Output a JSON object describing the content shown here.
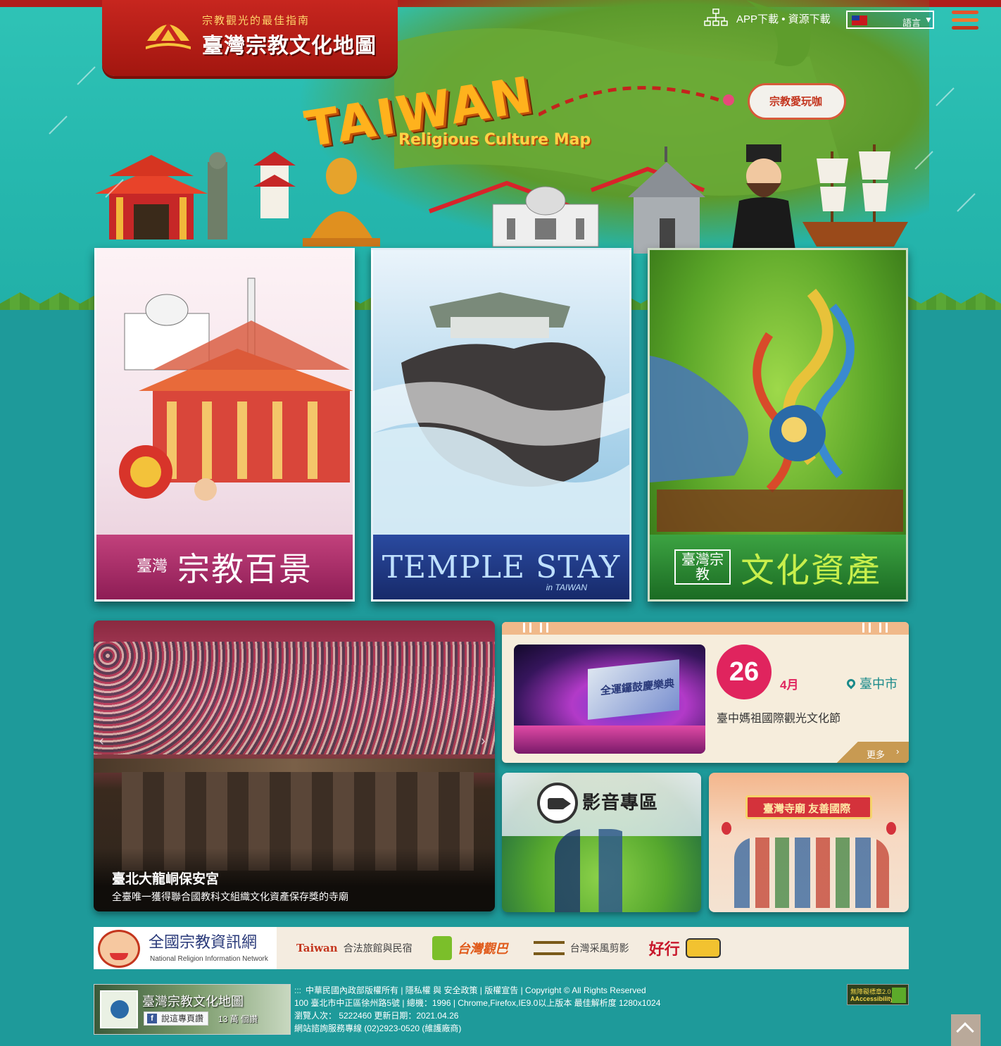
{
  "header": {
    "slogan": "宗教觀光的最佳指南",
    "site_title": "臺灣宗教文化地圖",
    "app_link": "APP下載",
    "resource_link": "資源下載",
    "separator": "•",
    "language_label": "語言",
    "language_caret": "▼"
  },
  "hero": {
    "title": "TAIWAN",
    "subtitle": "Religious Culture Map",
    "plane_text": "宗教愛玩咖"
  },
  "cards": [
    {
      "pre": "臺灣",
      "main": "宗教百景"
    },
    {
      "main": "TEMPLE STAY",
      "sub": "in TAIWAN"
    },
    {
      "pre": "臺灣宗教",
      "main": "文化資產"
    }
  ],
  "feature": {
    "title": "臺北大龍峒保安宮",
    "description": "全臺唯一獲得聯合國教科文組織文化資產保存獎的寺廟",
    "prev": "‹",
    "next": "›"
  },
  "event": {
    "day": "26",
    "month": "4月",
    "location": "臺中市",
    "name": "臺中媽祖國際觀光文化節",
    "more": "更多",
    "more_chevron": "›",
    "image_caption": "全運鑼鼓慶樂典"
  },
  "tiles": {
    "video_title": "影音專區",
    "temple_banner": "臺灣寺廟 友善國際"
  },
  "partners": {
    "news_cn": "全國宗教資訊網",
    "news_en": "National Religion Information Network",
    "legal_mark": "Taiwan",
    "legal_text": "合法旅館與民宿",
    "bus_mark": "台灣觀巴",
    "photo_text": "台灣采風剪影",
    "good_mark": "好行"
  },
  "footer": {
    "fb_name": "臺灣宗教文化地圖",
    "fb_like": "說這專頁讚",
    "fb_icon": "f",
    "fb_count": "13 萬 個讚",
    "dots": ":::",
    "copyright_line": "中華民國內政部版權所有 | 隱私權 與 安全政策 | 版權宣告 | Copyright © All Rights Reserved",
    "address_line": "100 臺北市中正區徐州路5號 | 總機：1996 | Chrome,Firefox,IE9.0以上版本 最佳解析度 1280x1024",
    "visits_line": "瀏覽人次： 5222460 更新日期：2021.04.26",
    "service_line": "網站諮詢服務專線 (02)2923-0520 (維護廠商)",
    "badge_line1": "無障礙標章2.0",
    "badge_line2": "AAccessibility"
  },
  "colors": {
    "accent_red": "#c7261f",
    "teal_bg": "#1e9a9a",
    "event_day": "#e0245e"
  }
}
